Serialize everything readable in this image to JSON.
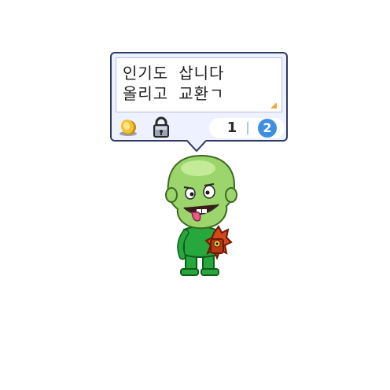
{
  "bubble": {
    "lines": [
      "인기도 삽니다",
      "올리고 교환ㄱ"
    ]
  },
  "pager": {
    "page_1": "1",
    "page_2": "2",
    "current_page": 2
  },
  "icons": {
    "coin": "gold-coin-icon",
    "lock": "padlock-icon",
    "corner": "resize-corner-icon"
  },
  "colors": {
    "bubble_border": "#2d3a63",
    "bubble_bg": "#eef1ff",
    "active_page": "#3f8fe0",
    "character_skin": "#9bd56b",
    "character_suit": "#27a83c"
  }
}
